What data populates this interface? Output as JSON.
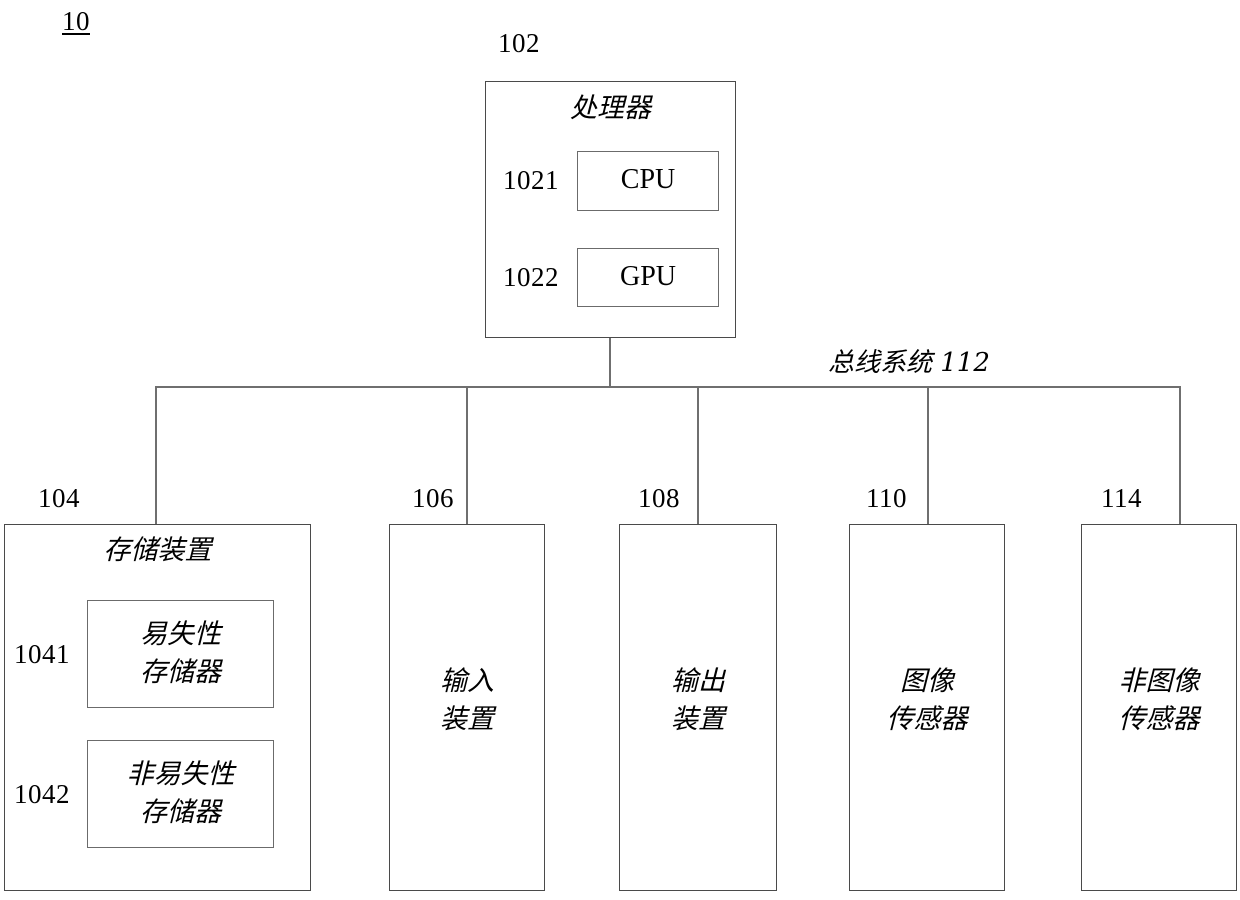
{
  "figure": {
    "id_label": "10"
  },
  "processor": {
    "numeral": "102",
    "title": "处理器",
    "units": [
      {
        "numeral": "1021",
        "label": "CPU"
      },
      {
        "numeral": "1022",
        "label": "GPU"
      }
    ]
  },
  "bus": {
    "caption": "总线系统 112"
  },
  "modules": [
    {
      "numeral": "104",
      "title": "存储装置",
      "sub_units": [
        {
          "numeral": "1041",
          "label": "易失性\n存储器"
        },
        {
          "numeral": "1042",
          "label": "非易失性\n存储器"
        }
      ]
    },
    {
      "numeral": "106",
      "title": "输入\n装置",
      "sub_units": []
    },
    {
      "numeral": "108",
      "title": "输出\n装置",
      "sub_units": []
    },
    {
      "numeral": "110",
      "title": "图像\n传感器",
      "sub_units": []
    },
    {
      "numeral": "114",
      "title": "非图像\n传感器",
      "sub_units": []
    }
  ],
  "colors": {
    "stroke": "#4a4a4a",
    "inner_stroke": "#6b6b6b",
    "line": "#6f6f6f",
    "text": "#000000",
    "background": "#ffffff"
  }
}
